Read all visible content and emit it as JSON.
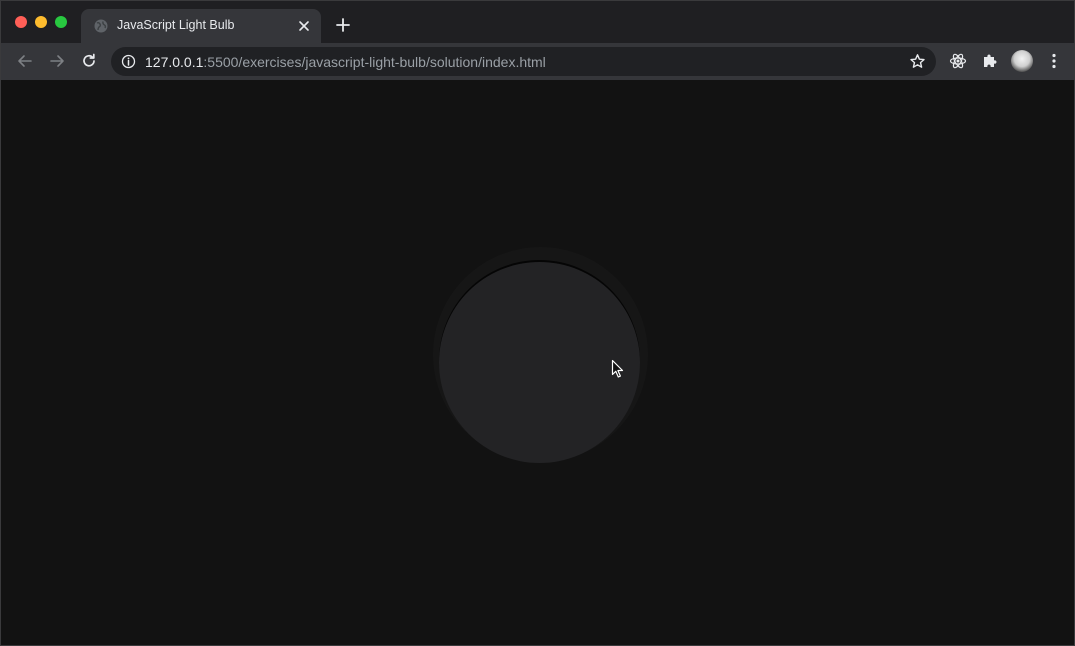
{
  "browser": {
    "tab": {
      "title": "JavaScript Light Bulb",
      "favicon": "globe-icon",
      "close_icon": "close-icon"
    },
    "new_tab_icon": "plus-icon",
    "toolbar": {
      "back_icon": "back-arrow-icon",
      "forward_icon": "forward-arrow-icon",
      "reload_icon": "reload-icon",
      "url_host": "127.0.0.1",
      "url_rest": ":5500/exercises/javascript-light-bulb/solution/index.html",
      "site_info_icon": "info-icon",
      "bookmark_icon": "star-icon",
      "extensions": [
        "react-devtools-icon",
        "puzzle-icon"
      ],
      "profile": "avatar",
      "menu_icon": "kebab-menu-icon"
    },
    "traffic_lights": {
      "close": "#ff5f57",
      "minimize": "#febc2e",
      "maximize": "#28c840"
    }
  },
  "page": {
    "background": "#121212",
    "bulb": {
      "state": "off",
      "color": "#232325"
    }
  }
}
